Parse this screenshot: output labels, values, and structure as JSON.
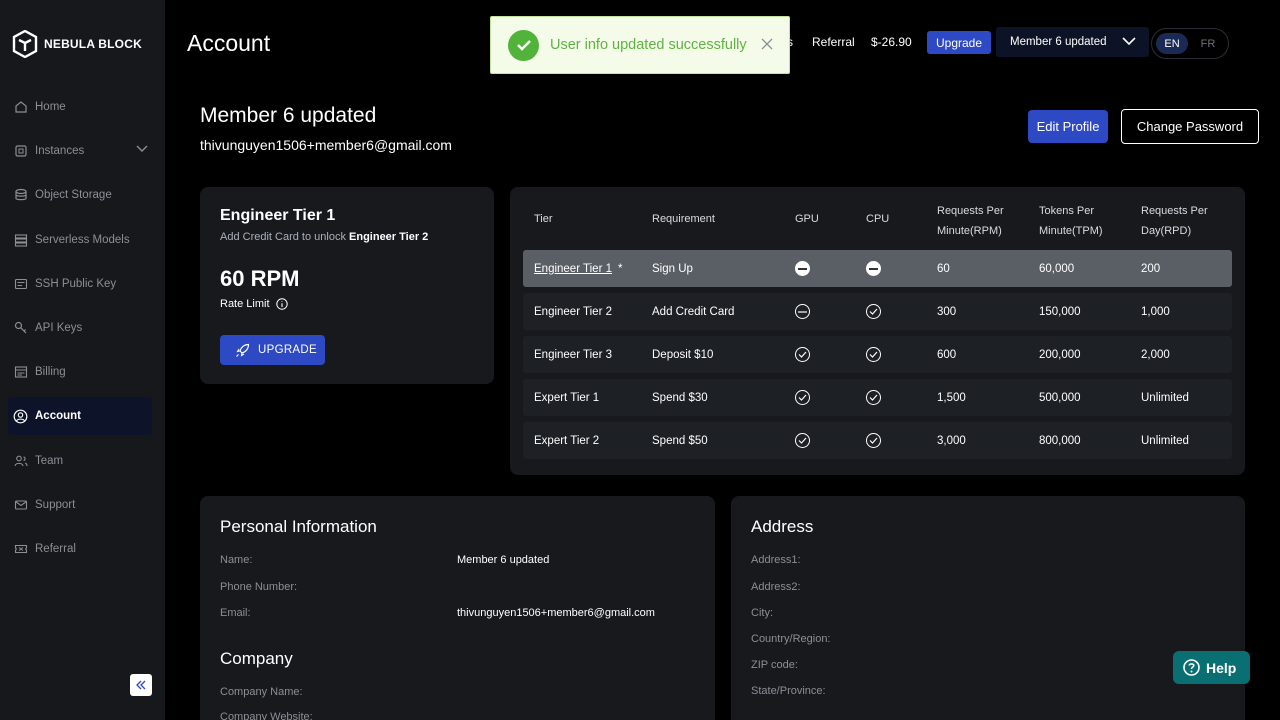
{
  "brand": {
    "name": "NEBULA BLOCK"
  },
  "sidebar": {
    "items": [
      {
        "label": "Home",
        "icon": "home-icon"
      },
      {
        "label": "Instances",
        "icon": "cpu-icon"
      },
      {
        "label": "Object Storage",
        "icon": "database-icon"
      },
      {
        "label": "Serverless Models",
        "icon": "server-icon"
      },
      {
        "label": "SSH Public Key",
        "icon": "key-card-icon"
      },
      {
        "label": "API Keys",
        "icon": "key-icon"
      },
      {
        "label": "Billing",
        "icon": "billing-icon"
      },
      {
        "label": "Account",
        "icon": "user-circle-icon",
        "active": true
      },
      {
        "label": "Team",
        "icon": "team-icon"
      },
      {
        "label": "Support",
        "icon": "mail-icon"
      },
      {
        "label": "Referral",
        "icon": "ticket-icon"
      }
    ]
  },
  "header": {
    "title": "Account",
    "partial_link": "s",
    "referral": "Referral",
    "balance": "$-26.90",
    "upgrade": "Upgrade",
    "user": "Member 6 updated",
    "lang_en": "EN",
    "lang_fr": "FR"
  },
  "toast": {
    "message": "User info updated successfully"
  },
  "profile": {
    "name": "Member 6 updated",
    "email": "thivunguyen1506+member6@gmail.com",
    "edit_label": "Edit Profile",
    "password_label": "Change Password"
  },
  "tier": {
    "title": "Engineer Tier 1",
    "sub_prefix": "Add Credit Card to unlock",
    "sub_target": "Engineer Tier 2",
    "rpm": "60 RPM",
    "rate_label": "Rate Limit",
    "upgrade_label": "UPGRADE"
  },
  "tiers_table": {
    "headers": [
      "Tier",
      "Requirement",
      "GPU",
      "CPU",
      "Requests Per Minute(RPM)",
      "Tokens Per Minute(TPM)",
      "Requests Per Day(RPD)"
    ],
    "rows": [
      {
        "tier": "Engineer Tier 1",
        "star": "*",
        "requirement": "Sign Up",
        "gpu": "disabled",
        "cpu": "disabled",
        "rpm": "60",
        "tpm": "60,000",
        "rpd": "200"
      },
      {
        "tier": "Engineer Tier 2",
        "requirement": "Add Credit Card",
        "gpu": "no",
        "cpu": "yes",
        "rpm": "300",
        "tpm": "150,000",
        "rpd": "1,000"
      },
      {
        "tier": "Engineer Tier 3",
        "requirement": "Deposit $10",
        "gpu": "yes",
        "cpu": "yes",
        "rpm": "600",
        "tpm": "200,000",
        "rpd": "2,000"
      },
      {
        "tier": "Expert Tier 1",
        "requirement": "Spend $30",
        "gpu": "yes",
        "cpu": "yes",
        "rpm": "1,500",
        "tpm": "500,000",
        "rpd": "Unlimited"
      },
      {
        "tier": "Expert Tier 2",
        "requirement": "Spend $50",
        "gpu": "yes",
        "cpu": "yes",
        "rpm": "3,000",
        "tpm": "800,000",
        "rpd": "Unlimited"
      }
    ]
  },
  "personal": {
    "title": "Personal Information",
    "name_label": "Name:",
    "name_value": "Member 6 updated",
    "phone_label": "Phone Number:",
    "email_label": "Email:",
    "email_value": "thivunguyen1506+member6@gmail.com"
  },
  "company": {
    "title": "Company",
    "name_label": "Company Name:",
    "website_label": "Company Website:"
  },
  "address": {
    "title": "Address",
    "labels": [
      "Address1:",
      "Address2:",
      "City:",
      "Country/Region:",
      "ZIP code:",
      "State/Province:"
    ]
  },
  "help": {
    "label": "Help"
  }
}
